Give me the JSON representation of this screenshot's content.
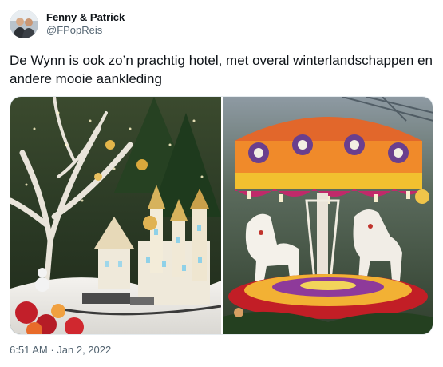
{
  "author": {
    "display_name": "Fenny & Patrick",
    "handle": "@FPopReis"
  },
  "tweet": {
    "text": "De Wynn is ook zo’n prachtig hotel, met overal winterlandschappen en andere mooie aankleding"
  },
  "media": {
    "photo_left_label": "",
    "photo_right_label": ""
  },
  "meta": {
    "time": "6:51 AM",
    "separator": " · ",
    "date": "Jan 2, 2022"
  },
  "colors": {
    "text": "#0f1419",
    "secondary": "#536471"
  }
}
